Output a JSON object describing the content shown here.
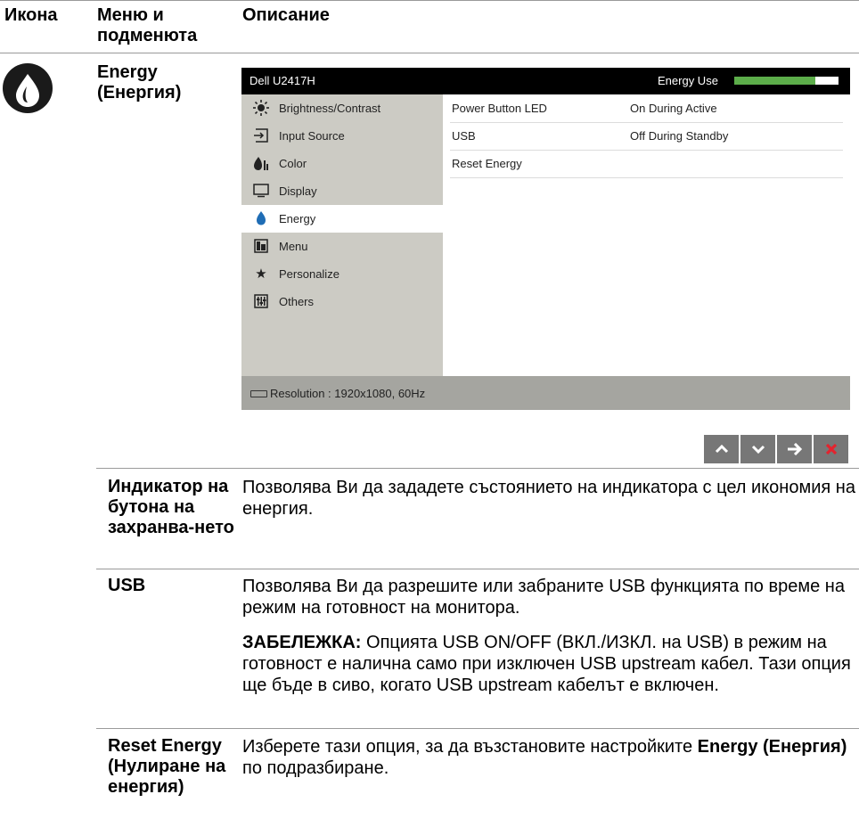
{
  "header": {
    "col_icon": "Икона",
    "col_menu": "Меню и подменюта",
    "col_desc": "Описание"
  },
  "energy_title": "Energy (Енергия)",
  "osd": {
    "model": "Dell U2417H",
    "energy_use_label": "Energy Use",
    "energy_use_level": 0.78,
    "menu": [
      {
        "label": "Brightness/Contrast",
        "icon": "brightness-icon"
      },
      {
        "label": "Input Source",
        "icon": "input-source-icon"
      },
      {
        "label": "Color",
        "icon": "color-icon"
      },
      {
        "label": "Display",
        "icon": "display-icon"
      },
      {
        "label": "Energy",
        "icon": "energy-icon",
        "selected": true
      },
      {
        "label": "Menu",
        "icon": "menu-icon"
      },
      {
        "label": "Personalize",
        "icon": "star-icon"
      },
      {
        "label": "Others",
        "icon": "others-icon"
      }
    ],
    "rows": [
      {
        "label": "Power Button LED",
        "value": "On During Active"
      },
      {
        "label": "USB",
        "value": "Off During Standby"
      },
      {
        "label": "Reset Energy",
        "value": ""
      }
    ],
    "resolution": "Resolution : 1920x1080, 60Hz"
  },
  "nav_buttons": [
    "up",
    "down",
    "right",
    "close"
  ],
  "items": [
    {
      "term": "Индикатор на бутона на захранва-нето",
      "desc": "Позволява Ви да зададете състоянието на индикатора с цел икономия на енергия."
    },
    {
      "term": "USB",
      "desc": "Позволява Ви да разрешите или забраните USB функцията по време на режим на готовност на монитора.",
      "note_label": "ЗАБЕЛЕЖКА:",
      "note": " Опцията USB ON/OFF (ВКЛ./ИЗКЛ. на USB) в режим на готовност е налична само при изключен USB upstream кабел. Тази опция ще бъде в сиво, когато USB upstream кабелът е включен."
    },
    {
      "term": "Reset Energy (Нулиране на енергия)",
      "desc_pre": "Изберете тази опция, за да възстановите настройките ",
      "desc_bold": "Energy (Енергия)",
      "desc_post": " по подразбиране."
    }
  ]
}
